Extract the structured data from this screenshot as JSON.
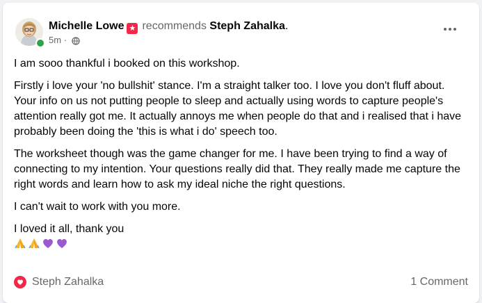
{
  "post": {
    "author": "Michelle Lowe",
    "verb": "recommends",
    "target": "Steph Zahalka",
    "target_suffix": ".",
    "time": "5m",
    "time_sep": "·",
    "paragraphs": [
      "I am sooo thankful i booked on this workshop.",
      "Firstly i love your 'no bullshit' stance. I'm a straight talker too. I love you don't fluff about.",
      "Your info on us not putting people to sleep and actually using words to capture people's attention really got me. It actually annoys me when people do that and i realised that i have probably been doing the 'this is what i do' speech too.",
      "The worksheet though was the game changer for me. I have been trying to find a way of connecting to my intention. Your questions really did that. They really made me capture the right words and learn how to ask my ideal niche the right questions.",
      "I can't wait to work with you more.",
      "I loved it all, thank you"
    ],
    "emojis": [
      "folded-hands",
      "folded-hands",
      "purple-heart",
      "purple-heart"
    ]
  },
  "footer": {
    "reactor": "Steph Zahalka",
    "comments": "1 Comment"
  },
  "colors": {
    "accent_red": "#f02849",
    "online_green": "#31a24c",
    "secondary_text": "#65676b",
    "purple_heart": "#9b59d0"
  }
}
